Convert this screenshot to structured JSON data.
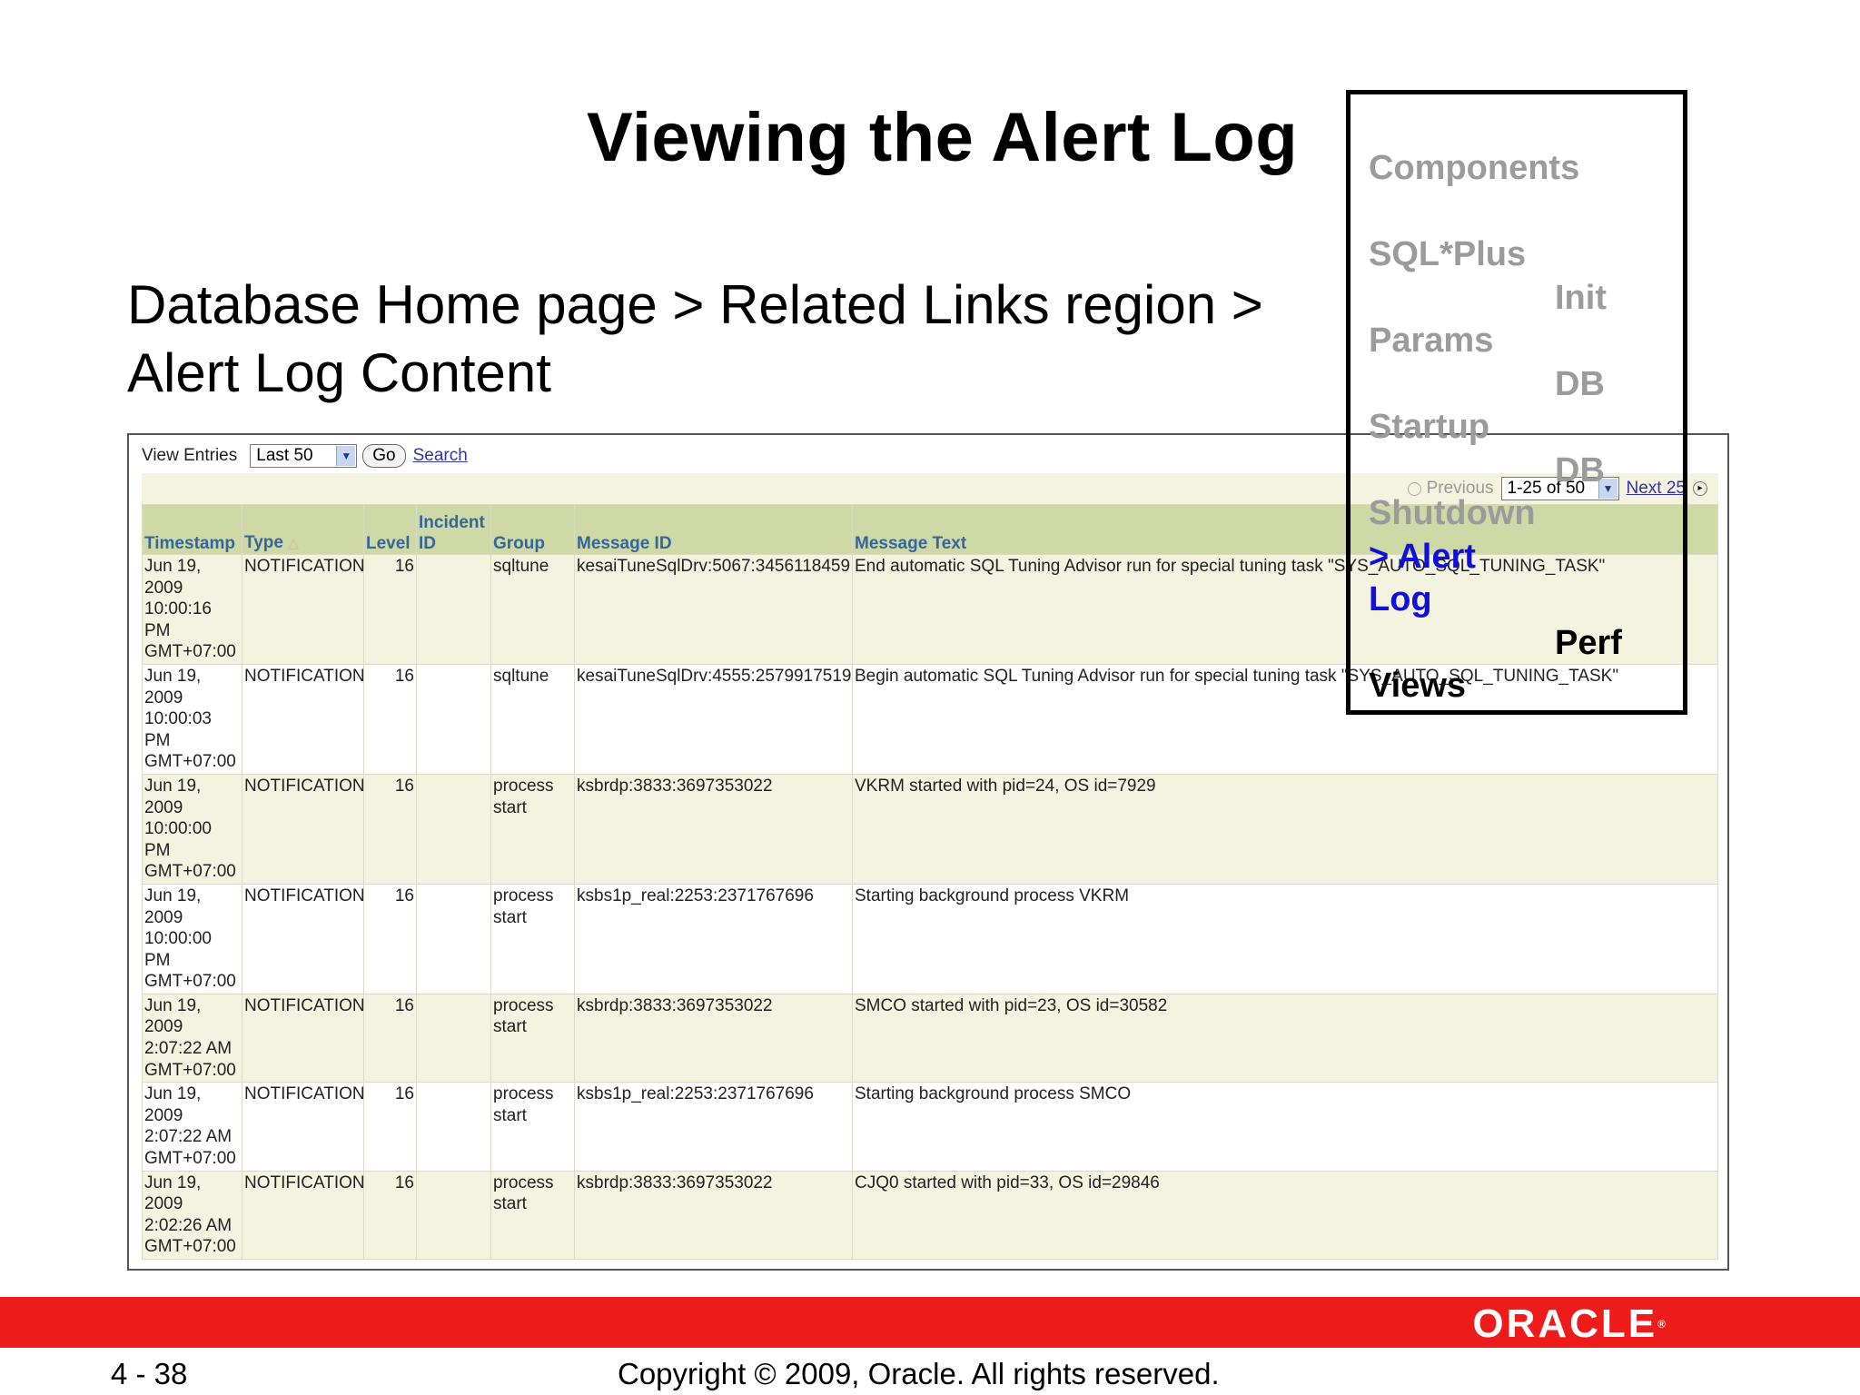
{
  "slide": {
    "title": "Viewing the Alert Log",
    "subtitle_line1": "Database Home page > Related Links region >",
    "subtitle_line2": "Alert Log Content",
    "page_number": "4 - 38",
    "copyright": "Copyright © 2009, Oracle. All rights reserved.",
    "logo": "ORACLE",
    "logo_mark": "®"
  },
  "nav": {
    "components": "Components",
    "sqlplus": "SQL*Plus",
    "init": "Init",
    "params": "Params",
    "db1": "DB",
    "startup": "Startup",
    "db2": "DB",
    "shutdown": "Shutdown",
    "alert_prefix": "> Alert",
    "log": "Log",
    "perf": "Perf",
    "views": "Views"
  },
  "toolbar": {
    "view_entries_label": "View Entries",
    "view_entries_value": "Last 50",
    "go_label": "Go",
    "search_label": "Search"
  },
  "pager": {
    "previous": "Previous",
    "range": "1-25 of 50",
    "next": "Next 25"
  },
  "table": {
    "headers": {
      "timestamp": "Timestamp",
      "type": "Type",
      "level": "Level",
      "incident_id_1": "Incident",
      "incident_id_2": "ID",
      "group": "Group",
      "message_id": "Message ID",
      "message_text": "Message Text"
    },
    "rows": [
      {
        "ts1": "Jun 19,",
        "ts2": "2009",
        "ts3": "10:00:16",
        "ts4": "PM",
        "ts5": "GMT+07:00",
        "type": "NOTIFICATION",
        "level": "16",
        "incident": "",
        "group1": "sqltune",
        "group2": "",
        "msgid": "kesaiTuneSqlDrv:5067:3456118459",
        "text": "End automatic SQL Tuning Advisor run for special tuning task \"SYS_AUTO_SQL_TUNING_TASK\""
      },
      {
        "ts1": "Jun 19,",
        "ts2": "2009",
        "ts3": "10:00:03",
        "ts4": "PM",
        "ts5": "GMT+07:00",
        "type": "NOTIFICATION",
        "level": "16",
        "incident": "",
        "group1": "sqltune",
        "group2": "",
        "msgid": "kesaiTuneSqlDrv:4555:2579917519",
        "text": "Begin automatic SQL Tuning Advisor run for special tuning task \"SYS_AUTO_SQL_TUNING_TASK\""
      },
      {
        "ts1": "Jun 19,",
        "ts2": "2009",
        "ts3": "10:00:00",
        "ts4": "PM",
        "ts5": "GMT+07:00",
        "type": "NOTIFICATION",
        "level": "16",
        "incident": "",
        "group1": "process",
        "group2": "start",
        "msgid": "ksbrdp:3833:3697353022",
        "text": "VKRM started with pid=24, OS id=7929"
      },
      {
        "ts1": "Jun 19,",
        "ts2": "2009",
        "ts3": "10:00:00",
        "ts4": "PM",
        "ts5": "GMT+07:00",
        "type": "NOTIFICATION",
        "level": "16",
        "incident": "",
        "group1": "process",
        "group2": "start",
        "msgid": "ksbs1p_real:2253:2371767696",
        "text": "Starting background process VKRM"
      },
      {
        "ts1": "Jun 19,",
        "ts2": "2009",
        "ts3": "2:07:22 AM",
        "ts4": "GMT+07:00",
        "ts5": "",
        "type": "NOTIFICATION",
        "level": "16",
        "incident": "",
        "group1": "process",
        "group2": "start",
        "msgid": "ksbrdp:3833:3697353022",
        "text": "SMCO started with pid=23, OS id=30582"
      },
      {
        "ts1": "Jun 19,",
        "ts2": "2009",
        "ts3": "2:07:22 AM",
        "ts4": "GMT+07:00",
        "ts5": "",
        "type": "NOTIFICATION",
        "level": "16",
        "incident": "",
        "group1": "process",
        "group2": "start",
        "msgid": "ksbs1p_real:2253:2371767696",
        "text": "Starting background process SMCO"
      },
      {
        "ts1": "Jun 19,",
        "ts2": "2009",
        "ts3": "2:02:26 AM",
        "ts4": "GMT+07:00",
        "ts5": "",
        "type": "NOTIFICATION",
        "level": "16",
        "incident": "",
        "group1": "process",
        "group2": "start",
        "msgid": "ksbrdp:3833:3697353022",
        "text": "CJQ0 started with pid=33, OS id=29846"
      }
    ]
  }
}
